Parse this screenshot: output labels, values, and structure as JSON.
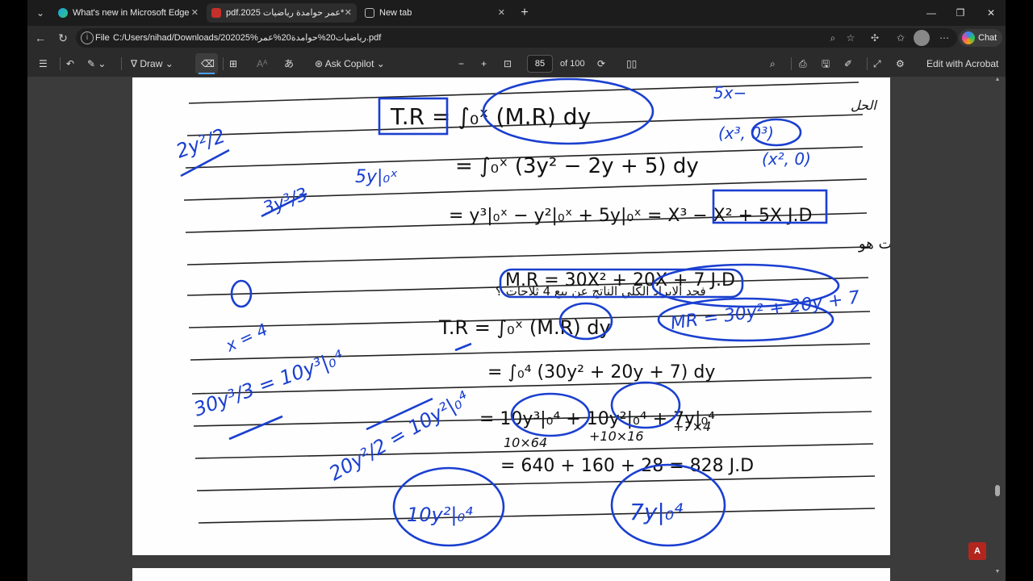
{
  "browser": {
    "tabs": [
      {
        "label": "What's new in Microsoft Edge",
        "icon": "edge-icon",
        "active": false
      },
      {
        "label": "pdf.2025 عمر حوامدة رياضيات*",
        "icon": "pdf-icon",
        "active": true
      },
      {
        "label": "New tab",
        "icon": "new-tab-page-icon",
        "active": false
      }
    ],
    "address": {
      "scheme_label": "File",
      "url": "C:/Users/nihad/Downloads/202025%رياضيات20%حوامدة20%عمر.pdf"
    },
    "chat_label": "Chat"
  },
  "pdf_toolbar": {
    "draw_label": "Draw",
    "ask_copilot_label": "Ask Copilot",
    "page_current": "85",
    "page_total": "of 100",
    "edit_acrobat_label": "Edit with Acrobat",
    "aa_label": "あ"
  },
  "document": {
    "printed_lines": [
      "T.R = ∫₀ˣ (M.R) dy",
      "= ∫₀ˣ (3y² − 2y + 5) dy",
      "= y³|₀ˣ − y²|₀ˣ + 5y|₀ˣ = X³ − X² + 5X J.D",
      "مثال : اذا كان اقتران الايراد الحدي الشهري لبيع ثلاجات هو",
      "M.R = 30X² + 20X + 7 J.D",
      "فجد الايراد الكلي الناتج عن بيع 4 ثلاجات ؟",
      "T.R = ∫₀ˣ (M.R) dy",
      "= ∫₀⁴ (30y² + 20y + 7) dy",
      "= 10y³|₀⁴ + 10y²|₀⁴ + 7y|₀⁴",
      "= 640 + 160 + 28 = 828 J.D"
    ],
    "annotations": [
      "5x−",
      "الحل",
      "2y²/2",
      "3y³/3",
      "5y|₀ˣ",
      "(x³, 0³)",
      "(x², 0)",
      "MR = 30y² + 20y + 7",
      "x = 4",
      "30y³/3 = 10y³|₀⁴",
      "20y²/2 = 10y²|₀⁴",
      "10×64",
      "+10×16",
      "+7×4",
      "10y²|₀⁴",
      "7y|₀⁴"
    ]
  },
  "colors": {
    "ink_blue": "#1a3fd0",
    "print_black": "#111111",
    "acrobat_red": "#b3261e"
  }
}
